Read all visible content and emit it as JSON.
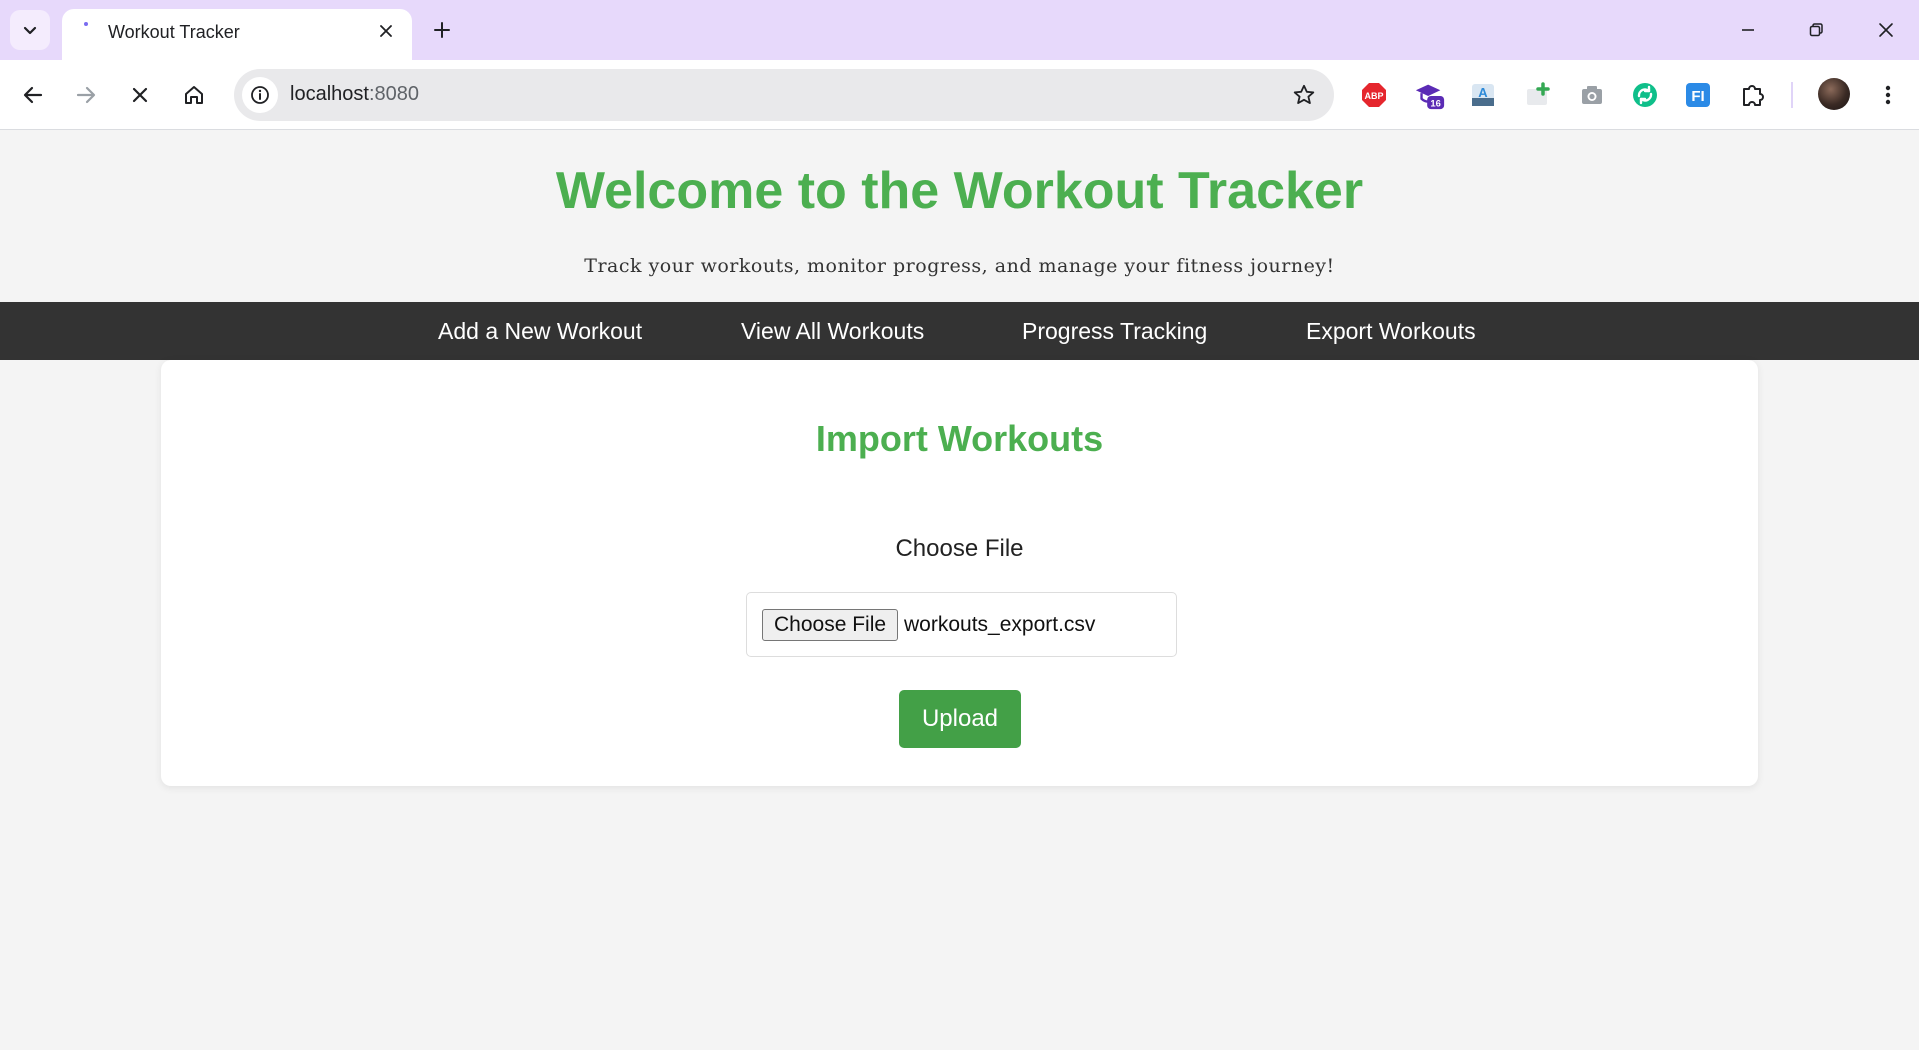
{
  "browser": {
    "tab": {
      "title": "Workout Tracker"
    },
    "address_bar": {
      "host": "localhost",
      "port": ":8080"
    },
    "extensions": [
      {
        "name": "adblock-plus-icon",
        "label": "ABP",
        "color": "#e5262d"
      },
      {
        "name": "graduation-cap-icon",
        "badge": "16",
        "color": "#5b2bb5"
      },
      {
        "name": "translate-extension-icon",
        "label": "A",
        "color": "#2d8ad8"
      },
      {
        "name": "add-note-extension-icon",
        "color": "#34a853"
      },
      {
        "name": "camera-icon",
        "color": "#9aa0a6"
      },
      {
        "name": "sync-extension-icon",
        "color": "#0fbf8a"
      },
      {
        "name": "fi-extension-icon",
        "label": "FI",
        "color": "#2b8ae6"
      },
      {
        "name": "extensions-puzzle-icon"
      }
    ]
  },
  "site": {
    "title": "Welcome to the Workout Tracker",
    "tagline": "Track your workouts, monitor progress, and manage your fitness journey!"
  },
  "nav": {
    "items": [
      {
        "label": "Add a New Workout"
      },
      {
        "label": "View All Workouts"
      },
      {
        "label": "Progress Tracking"
      },
      {
        "label": "Export Workouts"
      }
    ]
  },
  "import_card": {
    "title": "Import Workouts",
    "file_label": "Choose File",
    "choose_button": "Choose File",
    "selected_file": "workouts_export.csv",
    "upload_button": "Upload"
  },
  "colors": {
    "brand_green": "#4caf50",
    "button_green": "#43a047",
    "nav_background": "#333333",
    "tab_strip": "#e7d9fb"
  }
}
